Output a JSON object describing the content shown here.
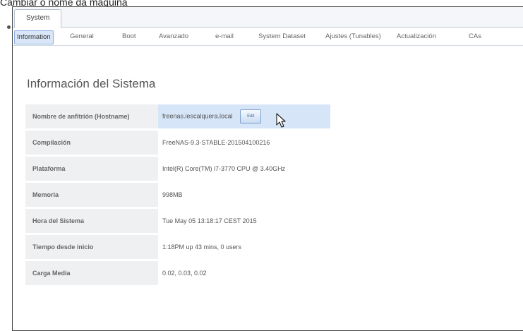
{
  "caption": "Cambiar o nome da máquina",
  "top_tab": "System",
  "sub_tabs": [
    {
      "label": "Information",
      "active": true
    },
    {
      "label": "General",
      "active": false
    },
    {
      "label": "Boot",
      "active": false
    },
    {
      "label": "Avanzado",
      "active": false
    },
    {
      "label": "e-mail",
      "active": false
    },
    {
      "label": "System Dataset",
      "active": false
    },
    {
      "label": "Ajustes (Tunables)",
      "active": false
    },
    {
      "label": "Actualización",
      "active": false
    },
    {
      "label": "CAs",
      "active": false
    }
  ],
  "section_title": "Información del Sistema",
  "rows": [
    {
      "label": "Nombre de anfitrión (Hostname)",
      "value": "freenas.iescalquera.local"
    },
    {
      "label": "Compilación",
      "value": "FreeNAS-9.3-STABLE-201504100216"
    },
    {
      "label": "Plataforma",
      "value": "Intel(R) Core(TM) i7-3770 CPU @ 3.40GHz"
    },
    {
      "label": "Memoria",
      "value": "998MB"
    },
    {
      "label": "Hora del Sistema",
      "value": "Tue May 05 13:18:17 CEST 2015"
    },
    {
      "label": "Tiempo desde inicio",
      "value": "1:18PM up 43 mins, 0 users"
    },
    {
      "label": "Carga Media",
      "value": "0.02, 0.03, 0.02"
    }
  ],
  "edit_label": "Edit",
  "icons": {
    "cursor": "mouse-pointer-icon",
    "bullet": "bullet-icon"
  }
}
